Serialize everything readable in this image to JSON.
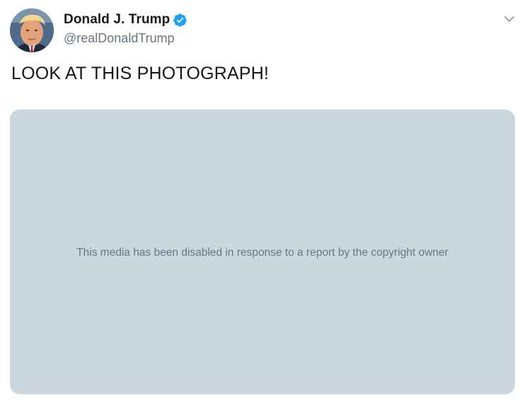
{
  "author": {
    "display_name": "Donald J. Trump",
    "handle": "@realDonaldTrump",
    "verified": true,
    "avatar_icon": "profile-photo"
  },
  "tweet": {
    "text": "LOOK AT THIS PHOTOGRAPH!"
  },
  "media": {
    "notice": "This media has been disabled in response to a report by the copyright owner",
    "background_color": "#ccd6dd"
  },
  "icons": {
    "verified": "verified-badge-icon",
    "menu": "chevron-down-icon"
  },
  "colors": {
    "verified_blue": "#1da1f2",
    "secondary_text": "#657786",
    "primary_text": "#14171a"
  }
}
